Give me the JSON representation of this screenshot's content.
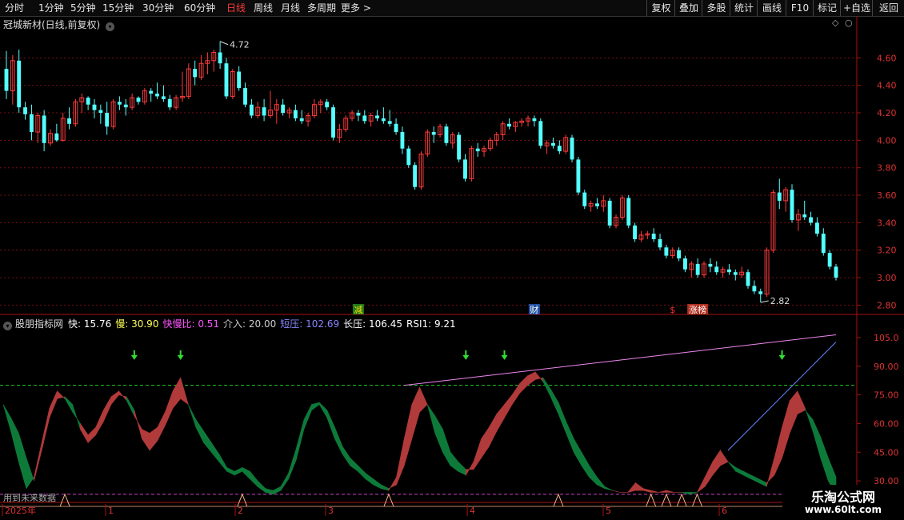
{
  "toolbar": {
    "periods": [
      {
        "label": "分时",
        "active": false
      },
      {
        "label": "1分钟",
        "active": false
      },
      {
        "label": "5分钟",
        "active": false
      },
      {
        "label": "15分钟",
        "active": false
      },
      {
        "label": "30分钟",
        "active": false
      },
      {
        "label": "60分钟",
        "active": false
      },
      {
        "label": "日线",
        "active": true
      },
      {
        "label": "周线",
        "active": false
      },
      {
        "label": "月线",
        "active": false
      },
      {
        "label": "多周期",
        "active": false
      },
      {
        "label": "更多 >",
        "active": false
      }
    ],
    "buttons": [
      "复权",
      "叠加",
      "多股",
      "统计",
      "画线",
      "F10",
      "标记",
      "+自选",
      "返回"
    ]
  },
  "price_panel": {
    "title": "冠城新材(日线,前复权)",
    "high_label": "4.72",
    "low_label": "2.82",
    "markers": [
      {
        "text": "减",
        "color": "#ffd700",
        "bg": "#1f7a1f"
      },
      {
        "text": "财",
        "color": "#ffffff",
        "bg": "#1f4fa0"
      },
      {
        "text": "$",
        "color": "#ff3333",
        "bg": ""
      },
      {
        "text": "涨榜",
        "color": "#ffffff",
        "bg": "#b03020"
      }
    ],
    "y_ticks": [
      "4.60",
      "4.40",
      "4.20",
      "4.00",
      "3.80",
      "3.60",
      "3.40",
      "3.20",
      "3.00",
      "2.80"
    ]
  },
  "indicator_panel": {
    "name": "股朋指标网",
    "values": [
      {
        "label": "快:",
        "value": "15.76",
        "color": "#ffffff"
      },
      {
        "label": "慢:",
        "value": "30.90",
        "color": "#ffff55"
      },
      {
        "label": "快慢比:",
        "value": "0.51",
        "color": "#ff55ff"
      },
      {
        "label": "介入:",
        "value": "20.00",
        "color": "#cccccc"
      },
      {
        "label": "短压:",
        "value": "102.69",
        "color": "#8888ff"
      },
      {
        "label": "长压:",
        "value": "106.45",
        "color": "#ffffff"
      },
      {
        "label": "RSI1:",
        "value": "9.21",
        "color": "#ffffff"
      }
    ],
    "y_ticks": [
      "105.0",
      "90.00",
      "75.00",
      "60.00",
      "45.00",
      "30.00"
    ],
    "bottom_note": "用到未来数据"
  },
  "timeline": {
    "labels": [
      "2025年",
      "1",
      "2",
      "3",
      "4",
      "5",
      "6"
    ]
  },
  "watermark": {
    "line1": "乐淘公式网",
    "line2": "www.60lt.com"
  },
  "chart_data": [
    {
      "type": "candlestick",
      "title": "冠城新材(日线,前复权)",
      "ylim": [
        2.75,
        4.8
      ],
      "annotations": {
        "high": 4.72,
        "low": 2.82
      },
      "ohlc": [
        [
          4.52,
          4.65,
          4.3,
          4.36
        ],
        [
          4.36,
          4.62,
          4.26,
          4.58
        ],
        [
          4.58,
          4.66,
          4.2,
          4.24
        ],
        [
          4.24,
          4.28,
          4.15,
          4.19
        ],
        [
          4.19,
          4.26,
          4.0,
          4.06
        ],
        [
          4.06,
          4.2,
          3.98,
          4.18
        ],
        [
          4.18,
          4.22,
          3.92,
          3.98
        ],
        [
          3.98,
          4.08,
          3.96,
          4.05
        ],
        [
          4.05,
          4.12,
          3.99,
          4.0
        ],
        [
          4.0,
          4.2,
          3.99,
          4.16
        ],
        [
          4.16,
          4.24,
          4.08,
          4.12
        ],
        [
          4.12,
          4.3,
          4.1,
          4.28
        ],
        [
          4.28,
          4.34,
          4.2,
          4.31
        ],
        [
          4.31,
          4.32,
          4.22,
          4.26
        ],
        [
          4.26,
          4.3,
          4.16,
          4.22
        ],
        [
          4.22,
          4.26,
          4.12,
          4.2
        ],
        [
          4.2,
          4.28,
          4.04,
          4.1
        ],
        [
          4.1,
          4.3,
          4.08,
          4.28
        ],
        [
          4.28,
          4.32,
          4.22,
          4.26
        ],
        [
          4.26,
          4.3,
          4.18,
          4.24
        ],
        [
          4.24,
          4.34,
          4.22,
          4.31
        ],
        [
          4.31,
          4.32,
          4.26,
          4.28
        ],
        [
          4.28,
          4.38,
          4.26,
          4.36
        ],
        [
          4.36,
          4.38,
          4.28,
          4.34
        ],
        [
          4.34,
          4.42,
          4.3,
          4.32
        ],
        [
          4.32,
          4.4,
          4.28,
          4.3
        ],
        [
          4.3,
          4.33,
          4.22,
          4.24
        ],
        [
          4.24,
          4.33,
          4.22,
          4.31
        ],
        [
          4.31,
          4.5,
          4.28,
          4.32
        ],
        [
          4.32,
          4.56,
          4.3,
          4.52
        ],
        [
          4.52,
          4.58,
          4.4,
          4.46
        ],
        [
          4.46,
          4.62,
          4.44,
          4.56
        ],
        [
          4.56,
          4.64,
          4.48,
          4.58
        ],
        [
          4.58,
          4.66,
          4.5,
          4.64
        ],
        [
          4.64,
          4.72,
          4.52,
          4.56
        ],
        [
          4.56,
          4.6,
          4.3,
          4.32
        ],
        [
          4.32,
          4.52,
          4.3,
          4.5
        ],
        [
          4.5,
          4.54,
          4.36,
          4.38
        ],
        [
          4.38,
          4.42,
          4.24,
          4.26
        ],
        [
          4.26,
          4.3,
          4.16,
          4.18
        ],
        [
          4.18,
          4.28,
          4.16,
          4.24
        ],
        [
          4.24,
          4.3,
          4.14,
          4.18
        ],
        [
          4.18,
          4.36,
          4.16,
          4.22
        ],
        [
          4.22,
          4.3,
          4.12,
          4.26
        ],
        [
          4.26,
          4.3,
          4.18,
          4.2
        ],
        [
          4.2,
          4.24,
          4.16,
          4.22
        ],
        [
          4.22,
          4.26,
          4.14,
          4.16
        ],
        [
          4.16,
          4.22,
          4.12,
          4.14
        ],
        [
          4.14,
          4.2,
          4.1,
          4.18
        ],
        [
          4.18,
          4.3,
          4.16,
          4.26
        ],
        [
          4.26,
          4.3,
          4.2,
          4.28
        ],
        [
          4.28,
          4.3,
          4.22,
          4.24
        ],
        [
          4.24,
          4.26,
          4.0,
          4.02
        ],
        [
          4.02,
          4.12,
          3.98,
          4.08
        ],
        [
          4.08,
          4.18,
          4.06,
          4.16
        ],
        [
          4.16,
          4.22,
          4.14,
          4.2
        ],
        [
          4.2,
          4.22,
          4.14,
          4.18
        ],
        [
          4.18,
          4.22,
          4.12,
          4.14
        ],
        [
          4.14,
          4.2,
          4.1,
          4.18
        ],
        [
          4.18,
          4.22,
          4.14,
          4.16
        ],
        [
          4.16,
          4.24,
          4.12,
          4.14
        ],
        [
          4.14,
          4.22,
          4.1,
          4.12
        ],
        [
          4.12,
          4.16,
          4.04,
          4.06
        ],
        [
          4.06,
          4.1,
          3.9,
          3.94
        ],
        [
          3.94,
          3.96,
          3.8,
          3.82
        ],
        [
          3.82,
          3.84,
          3.64,
          3.66
        ],
        [
          3.66,
          3.92,
          3.64,
          3.9
        ],
        [
          3.9,
          4.08,
          3.88,
          4.06
        ],
        [
          4.06,
          4.1,
          3.98,
          4.04
        ],
        [
          4.04,
          4.12,
          4.02,
          4.1
        ],
        [
          4.1,
          4.12,
          3.96,
          3.98
        ],
        [
          3.98,
          4.06,
          3.94,
          4.04
        ],
        [
          4.04,
          4.06,
          3.84,
          3.86
        ],
        [
          3.86,
          3.9,
          3.7,
          3.72
        ],
        [
          3.72,
          3.96,
          3.7,
          3.94
        ],
        [
          3.94,
          3.98,
          3.88,
          3.92
        ],
        [
          3.92,
          3.96,
          3.88,
          3.94
        ],
        [
          3.94,
          4.02,
          3.92,
          4.0
        ],
        [
          4.0,
          4.06,
          3.96,
          4.04
        ],
        [
          4.04,
          4.14,
          4.0,
          4.12
        ],
        [
          4.12,
          4.16,
          4.08,
          4.1
        ],
        [
          4.1,
          4.14,
          4.06,
          4.13
        ],
        [
          4.13,
          4.16,
          4.1,
          4.14
        ],
        [
          4.14,
          4.18,
          4.1,
          4.16
        ],
        [
          4.16,
          4.18,
          4.1,
          4.14
        ],
        [
          4.14,
          4.16,
          3.94,
          3.96
        ],
        [
          3.96,
          4.0,
          3.9,
          3.98
        ],
        [
          3.98,
          4.02,
          3.94,
          3.96
        ],
        [
          3.96,
          4.0,
          3.9,
          3.92
        ],
        [
          3.92,
          4.04,
          3.9,
          4.02
        ],
        [
          4.02,
          4.04,
          3.84,
          3.86
        ],
        [
          3.86,
          3.88,
          3.6,
          3.62
        ],
        [
          3.62,
          3.64,
          3.5,
          3.52
        ],
        [
          3.52,
          3.56,
          3.48,
          3.54
        ],
        [
          3.54,
          3.58,
          3.5,
          3.52
        ],
        [
          3.52,
          3.6,
          3.48,
          3.56
        ],
        [
          3.56,
          3.58,
          3.36,
          3.38
        ],
        [
          3.38,
          3.46,
          3.36,
          3.44
        ],
        [
          3.44,
          3.6,
          3.42,
          3.58
        ],
        [
          3.58,
          3.6,
          3.36,
          3.38
        ],
        [
          3.38,
          3.4,
          3.26,
          3.28
        ],
        [
          3.28,
          3.34,
          3.26,
          3.31
        ],
        [
          3.31,
          3.34,
          3.28,
          3.32
        ],
        [
          3.32,
          3.36,
          3.26,
          3.28
        ],
        [
          3.28,
          3.32,
          3.2,
          3.22
        ],
        [
          3.22,
          3.24,
          3.14,
          3.16
        ],
        [
          3.16,
          3.22,
          3.14,
          3.2
        ],
        [
          3.2,
          3.22,
          3.12,
          3.14
        ],
        [
          3.14,
          3.16,
          3.04,
          3.06
        ],
        [
          3.06,
          3.12,
          3.0,
          3.1
        ],
        [
          3.1,
          3.14,
          3.0,
          3.02
        ],
        [
          3.02,
          3.12,
          3.0,
          3.1
        ],
        [
          3.1,
          3.14,
          3.04,
          3.08
        ],
        [
          3.08,
          3.12,
          3.02,
          3.04
        ],
        [
          3.04,
          3.08,
          3.0,
          3.06
        ],
        [
          3.06,
          3.1,
          3.02,
          3.04
        ],
        [
          3.04,
          3.06,
          2.98,
          3.02
        ],
        [
          3.02,
          3.08,
          3.0,
          3.04
        ],
        [
          3.04,
          3.06,
          2.92,
          2.94
        ],
        [
          2.94,
          2.98,
          2.88,
          2.9
        ],
        [
          2.9,
          2.92,
          2.82,
          2.88
        ],
        [
          2.88,
          3.22,
          2.86,
          3.2
        ],
        [
          3.2,
          3.64,
          3.18,
          3.62
        ],
        [
          3.62,
          3.72,
          3.5,
          3.56
        ],
        [
          3.56,
          3.66,
          3.48,
          3.64
        ],
        [
          3.64,
          3.68,
          3.4,
          3.42
        ],
        [
          3.42,
          3.5,
          3.34,
          3.46
        ],
        [
          3.46,
          3.56,
          3.42,
          3.44
        ],
        [
          3.44,
          3.48,
          3.38,
          3.4
        ],
        [
          3.4,
          3.44,
          3.3,
          3.32
        ],
        [
          3.32,
          3.36,
          3.16,
          3.18
        ],
        [
          3.18,
          3.2,
          3.06,
          3.08
        ],
        [
          3.08,
          3.1,
          2.98,
          3.0
        ]
      ]
    },
    {
      "type": "area",
      "title": "股朋指标网",
      "ylim": [
        20,
        110
      ],
      "reference_lines": [
        {
          "value": 80,
          "style": "dashed-green"
        },
        {
          "value": 23,
          "style": "dashed-magenta"
        }
      ],
      "series": [
        {
          "name": "快",
          "values": [
            70,
            56,
            40,
            26,
            32,
            50,
            68,
            77,
            73,
            66,
            60,
            54,
            58,
            67,
            74,
            77,
            72,
            64,
            57,
            55,
            58,
            66,
            77,
            84,
            70,
            58,
            50,
            45,
            40,
            35,
            33,
            35,
            31,
            27,
            24,
            23,
            25,
            31,
            41,
            57,
            67,
            70,
            63,
            52,
            44,
            38,
            35,
            31,
            28,
            26,
            25,
            32,
            52,
            70,
            79,
            70,
            55,
            45,
            38,
            35,
            33,
            40,
            52,
            58,
            65,
            70,
            75,
            81,
            85,
            87,
            82,
            74,
            65,
            55,
            45,
            38,
            32,
            28,
            26,
            25,
            24,
            24,
            29,
            26,
            25,
            24,
            25,
            24,
            24,
            23,
            24,
            32,
            40,
            46,
            40,
            35,
            33,
            31,
            29,
            27,
            42,
            58,
            72,
            77,
            68,
            56,
            42,
            30,
            23
          ]
        },
        {
          "name": "慢",
          "values": [
            70,
            63,
            55,
            42,
            30,
            46,
            63,
            73,
            74,
            70,
            57,
            50,
            54,
            61,
            70,
            75,
            74,
            67,
            52,
            46,
            51,
            59,
            68,
            73,
            70,
            62,
            56,
            50,
            44,
            37,
            35,
            37,
            35,
            30,
            26,
            25,
            27,
            34,
            47,
            62,
            70,
            71,
            67,
            58,
            48,
            42,
            38,
            34,
            31,
            28,
            26,
            28,
            38,
            52,
            66,
            70,
            64,
            57,
            45,
            40,
            36,
            36,
            42,
            48,
            56,
            63,
            70,
            76,
            80,
            83,
            84,
            78,
            71,
            61,
            52,
            45,
            38,
            32,
            27,
            25,
            24,
            24,
            25,
            25,
            24,
            24,
            24,
            24,
            24,
            24,
            24,
            27,
            33,
            38,
            40,
            37,
            35,
            33,
            31,
            29,
            33,
            42,
            55,
            65,
            67,
            62,
            53,
            42,
            32
          ]
        }
      ],
      "signals": [
        {
          "type": "down-arrow",
          "index": 23
        },
        {
          "type": "down-arrow",
          "index": 31
        }
      ]
    }
  ]
}
